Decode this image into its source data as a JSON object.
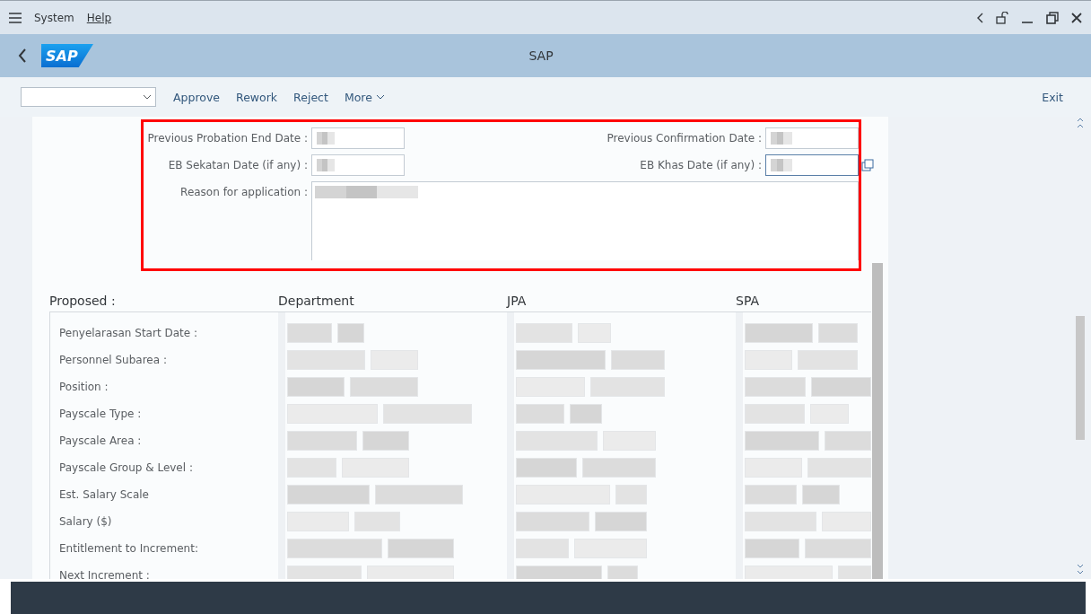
{
  "menu": {
    "items": [
      "System",
      "Help"
    ]
  },
  "header": {
    "title": "SAP",
    "logo": "SAP"
  },
  "toolbar": {
    "buttons": [
      "Approve",
      "Rework",
      "Reject"
    ],
    "more": "More",
    "exit": "Exit"
  },
  "form": {
    "fields": [
      {
        "label": "Previous Probation End Date :",
        "focused": false
      },
      {
        "label": "Previous Confirmation Date :",
        "focused": false
      },
      {
        "label": "EB Sekatan Date (if any) :",
        "focused": false
      },
      {
        "label": "EB Khas Date (if any) :",
        "focused": true
      }
    ],
    "reason_label": "Reason for application :"
  },
  "proposed": {
    "columns": [
      "Proposed :",
      "Department",
      "JPA",
      "SPA"
    ],
    "rows": [
      "Penyelarasan Start Date :",
      "Personnel Subarea :",
      "Position :",
      "Payscale Type :",
      "Payscale Area :",
      "Payscale Group & Level :",
      "Est. Salary Scale",
      "Salary ($)",
      "Entitlement to Increment:",
      "Next Increment :"
    ]
  }
}
